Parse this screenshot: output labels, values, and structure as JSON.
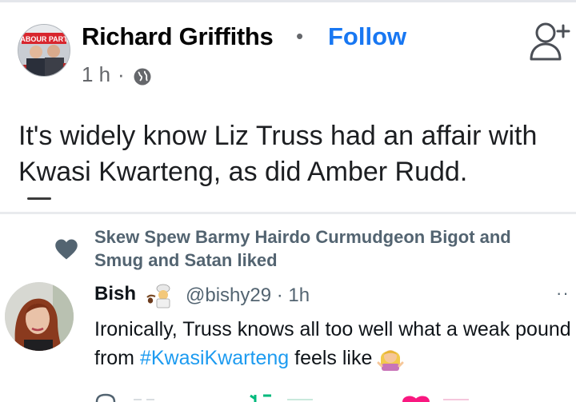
{
  "facebook_post": {
    "author": "Richard Griffiths",
    "separator": "•",
    "follow_label": "Follow",
    "time": "1 h",
    "time_separator": "·",
    "avatar_sign_text": "ABOUR PART",
    "text": "It's widely know Liz Truss had an affair with Kwasi Kwarteng, as did Amber Rudd."
  },
  "tweet": {
    "liked_by": "Skew Spew Barmy Hairdo Curmudgeon Bigot and Smug and Satan liked",
    "name": "Bish",
    "handle_time": "@bishy29 · 1h",
    "more": "··",
    "text_before": "Ironically, Truss knows all too well what a weak pound from ",
    "hashtag": "#KwasiKwarteng",
    "text_after": " feels like"
  },
  "colors": {
    "facebook_blue": "#1877f2",
    "twitter_blue": "#1d9bf0",
    "muted": "#536471",
    "heart": "#536471"
  },
  "icons": [
    "globe-icon",
    "add-friend-icon",
    "heart-icon",
    "emoji-pot-icon",
    "emoji-woman-icon",
    "more-icon"
  ]
}
